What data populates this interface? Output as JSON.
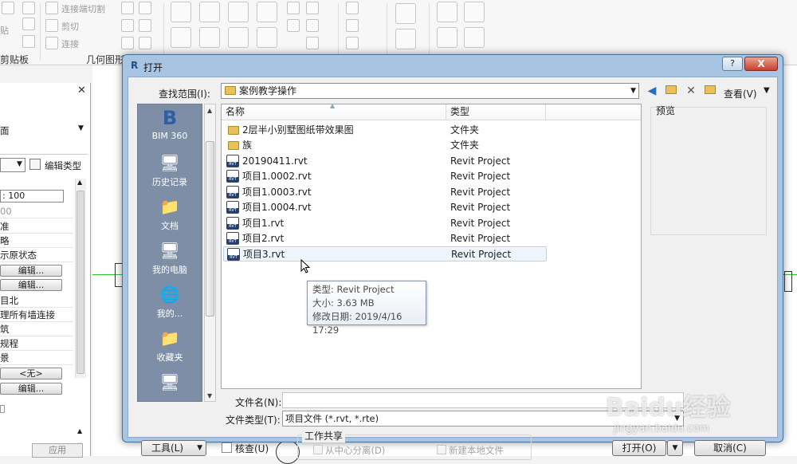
{
  "ribbon": {
    "items": [
      "连接端切割",
      "剪切",
      "连接"
    ],
    "panels": [
      "剪贴板",
      "几何图形"
    ]
  },
  "properties": {
    "close_icon": "close-icon",
    "type_dropdown_value": "面",
    "edit_type_label": "编辑类型",
    "scale_value": ": 100",
    "rows": [
      "00",
      "准",
      "略",
      "示原状态",
      "目北",
      "理所有墙连接",
      "筑",
      "规程",
      "景"
    ],
    "edit_label": "编辑...",
    "none_label": "<无>",
    "apply_label": "应用"
  },
  "dialog": {
    "title": "打开",
    "help_label": "?",
    "close_label": "X",
    "look_in_label": "查找范围(I):",
    "look_in_value": "案例教学操作",
    "view_label": "查看(V)",
    "toolbar_icons": [
      "back-arrow-icon",
      "up-folder-icon",
      "delete-icon",
      "new-folder-icon"
    ]
  },
  "places": [
    {
      "label": "BIM 360",
      "icon": "bim360-icon"
    },
    {
      "label": "历史记录",
      "icon": "history-icon"
    },
    {
      "label": "文档",
      "icon": "documents-icon"
    },
    {
      "label": "我的电脑",
      "icon": "computer-icon"
    },
    {
      "label": "我的...",
      "icon": "network-icon"
    },
    {
      "label": "收藏夹",
      "icon": "favorites-icon"
    },
    {
      "label": "",
      "icon": "desktop-icon"
    }
  ],
  "file_list": {
    "columns": {
      "name": "名称",
      "type": "类型"
    },
    "rows": [
      {
        "name": "2层半小别墅图纸带效果图",
        "type": "文件夹",
        "kind": "folder"
      },
      {
        "name": "族",
        "type": "文件夹",
        "kind": "folder"
      },
      {
        "name": "20190411.rvt",
        "type": "Revit Project",
        "kind": "rvt"
      },
      {
        "name": "项目1.0002.rvt",
        "type": "Revit Project",
        "kind": "rvt"
      },
      {
        "name": "项目1.0003.rvt",
        "type": "Revit Project",
        "kind": "rvt"
      },
      {
        "name": "项目1.0004.rvt",
        "type": "Revit Project",
        "kind": "rvt"
      },
      {
        "name": "项目1.rvt",
        "type": "Revit Project",
        "kind": "rvt"
      },
      {
        "name": "项目2.rvt",
        "type": "Revit Project",
        "kind": "rvt"
      },
      {
        "name": "项目3.rvt",
        "type": "Revit Project",
        "kind": "rvt"
      }
    ]
  },
  "tooltip": {
    "type_line": "类型: Revit Project",
    "size_line": "大小: 3.63 MB",
    "modified_line": "修改日期: 2019/4/16 17:29"
  },
  "preview": {
    "label": "预览"
  },
  "bottom": {
    "file_name_label": "文件名(N):",
    "file_name_value": "",
    "file_type_label": "文件类型(T):",
    "file_type_value": "项目文件 (*.rvt, *.rte)",
    "tools_label": "工具(L)",
    "audit_label": "核查(U)",
    "workshare_label": "工作共享",
    "detach_label": "从中心分离(D)",
    "new_local_label": "新建本地文件",
    "open_label": "打开(O)",
    "cancel_label": "取消(C)"
  },
  "watermark": {
    "text": "Baidu经验",
    "url": "jingyan.baidu.com"
  }
}
